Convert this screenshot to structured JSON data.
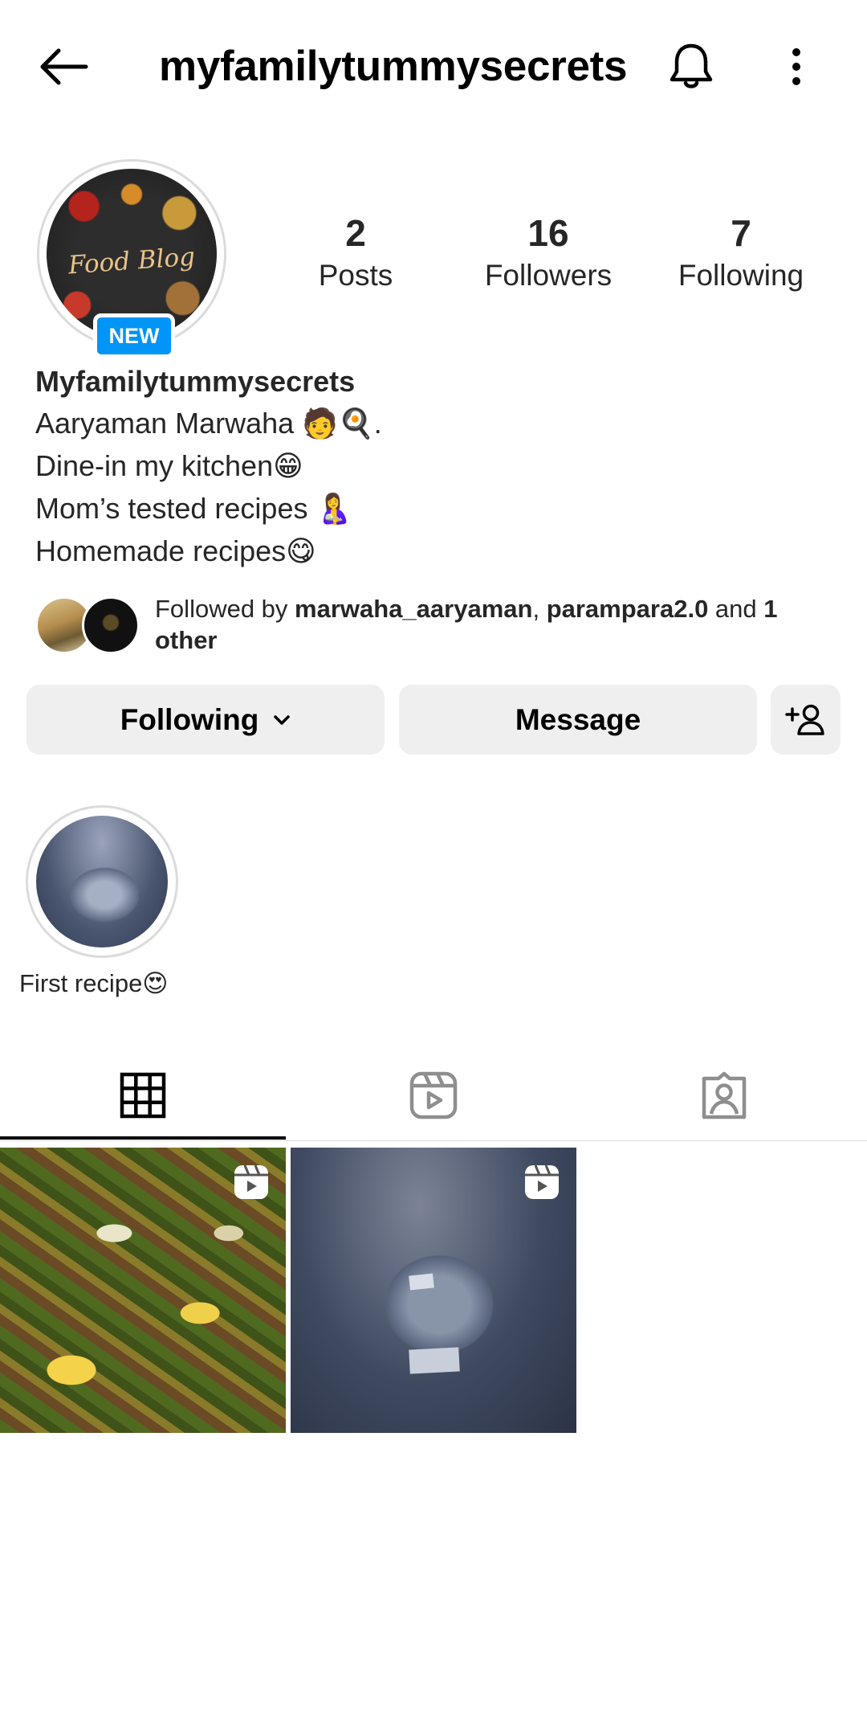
{
  "header": {
    "username": "myfamilytummysecrets"
  },
  "profile": {
    "avatar_text": "Food Blog",
    "new_badge": "NEW",
    "stats": {
      "posts": {
        "count": "2",
        "label": "Posts"
      },
      "followers": {
        "count": "16",
        "label": "Followers"
      },
      "following": {
        "count": "7",
        "label": "Following"
      }
    }
  },
  "bio": {
    "name": "Myfamilytummysecrets",
    "lines": [
      "Aaryaman Marwaha 🧑🍳.",
      "Dine-in my kitchen😁",
      "Mom’s tested recipes 🤱",
      "Homemade recipes😋"
    ]
  },
  "mutuals": {
    "prefix": "Followed by ",
    "user1": "marwaha_aaryaman",
    "sep": ", ",
    "user2": "parampara2.0",
    "and": " and ",
    "other": "1 other"
  },
  "actions": {
    "following_label": "Following",
    "message_label": "Message"
  },
  "highlights": [
    {
      "label": "First recipe😍"
    }
  ],
  "tabs": {
    "active": "grid",
    "items": [
      "grid-icon",
      "reels-icon",
      "tagged-icon"
    ]
  },
  "posts": [
    {
      "type": "reel",
      "subject": "bhindi"
    },
    {
      "type": "reel",
      "subject": "glass bowl"
    }
  ]
}
